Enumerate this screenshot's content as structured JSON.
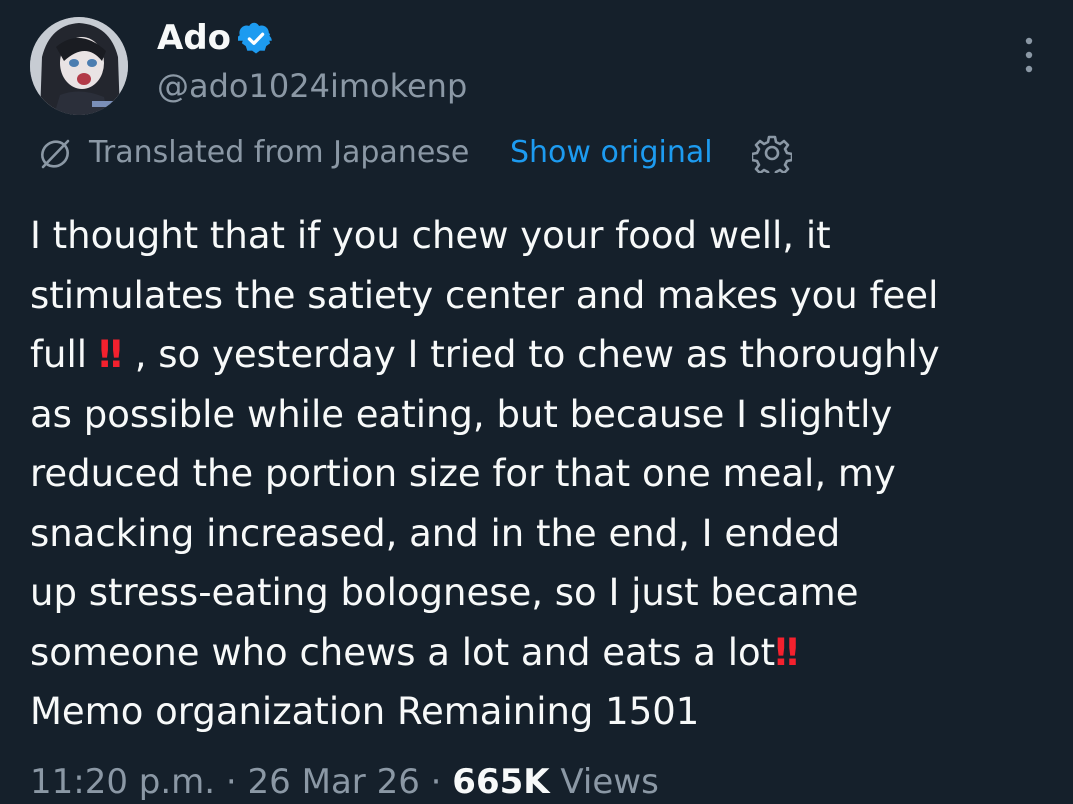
{
  "author": {
    "display_name": "Ado",
    "handle": "@ado1024imokenp",
    "verified": true,
    "verified_color": "#1d9bf0"
  },
  "translation": {
    "label": "Translated from Japanese",
    "show_original": "Show original",
    "link_color": "#1d9bf0"
  },
  "body": {
    "line1": "I thought that if you chew your food well, it",
    "line2": "stimulates the satiety center and makes you feel",
    "line3a": "full",
    "emoji1": "‼",
    "line3b": " , so yesterday I tried to chew as thoroughly",
    "line4": "as possible while eating, but because I slightly",
    "line5": "reduced the portion size for that one meal, my",
    "line6": "snacking increased, and in the end, I ended",
    "line7": "up stress-eating bolognese, so I just became",
    "line8a": "someone who chews a lot and eats a lot",
    "emoji2": "‼",
    "line9": "Memo organization  Remaining 1501"
  },
  "meta": {
    "time": "11:20 p.m.",
    "sep1": " · ",
    "date": "26 Mar 26",
    "sep2": " · ",
    "views_count": "665K",
    "views_label": " Views"
  },
  "colors": {
    "background": "#15202b",
    "text": "#f7f9f9",
    "secondary": "#8b98a5",
    "emoji_red": "#f4212e"
  },
  "icons": {
    "verified": "verified-badge-icon",
    "more": "more-vertical-icon",
    "translate": "translate-icon",
    "settings": "gear-icon"
  }
}
